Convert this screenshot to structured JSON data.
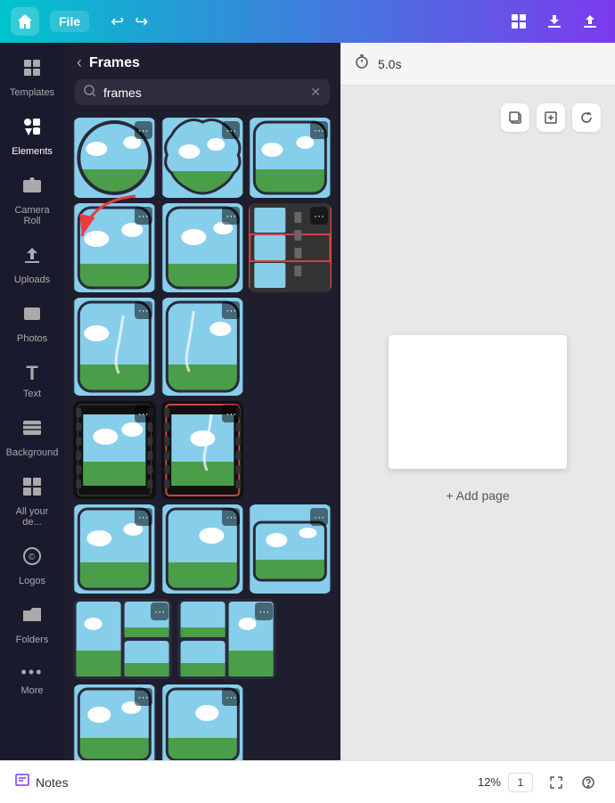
{
  "topbar": {
    "file_label": "File",
    "undo_icon": "↩",
    "redo_icon": "↪",
    "grid_icon": "⊞",
    "download_icon": "⬇",
    "share_icon": "⬆"
  },
  "sidebar": {
    "items": [
      {
        "id": "templates",
        "label": "Templates",
        "icon": "⊡"
      },
      {
        "id": "elements",
        "label": "Elements",
        "icon": "❖",
        "active": true
      },
      {
        "id": "camera-roll",
        "label": "Camera Roll",
        "icon": "📷"
      },
      {
        "id": "uploads",
        "label": "Uploads",
        "icon": "⬆"
      },
      {
        "id": "photos",
        "label": "Photos",
        "icon": "🖼"
      },
      {
        "id": "text",
        "label": "Text",
        "icon": "T"
      },
      {
        "id": "background",
        "label": "Background",
        "icon": "≋"
      },
      {
        "id": "all-your-de",
        "label": "All your de...",
        "icon": "⊞"
      },
      {
        "id": "logos",
        "label": "Logos",
        "icon": "©"
      },
      {
        "id": "folders",
        "label": "Folders",
        "icon": "📁"
      },
      {
        "id": "more",
        "label": "More",
        "icon": "···"
      }
    ]
  },
  "panel": {
    "back_label": "‹",
    "title": "Frames",
    "search_placeholder": "frames",
    "search_value": "frames",
    "clear_icon": "✕"
  },
  "canvas": {
    "timer": "5.0s",
    "add_page_label": "+ Add page",
    "copy_icon": "⧉",
    "add_icon": "+"
  },
  "bottom_bar": {
    "notes_label": "Notes",
    "zoom_label": "12%",
    "page_number": "1",
    "expand_icon": "⛶",
    "help_icon": "?"
  }
}
